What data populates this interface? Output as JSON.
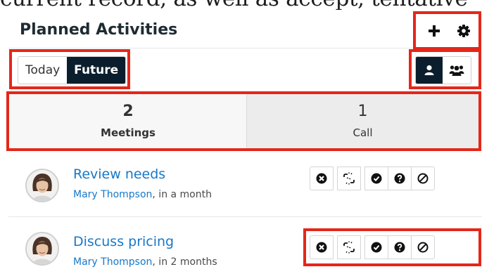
{
  "clipped_text": "current record, as well as accept, tentative",
  "dashlet": {
    "title": "Planned Activities",
    "add_icon": "plus-icon",
    "settings_icon": "gear-icon",
    "filter": {
      "today": "Today",
      "future": "Future",
      "selected": "Future"
    },
    "scope": {
      "mine_icon": "user-icon",
      "team_icon": "users-icon",
      "selected": "mine"
    },
    "tabs": [
      {
        "count": "2",
        "label": "Meetings",
        "active": true
      },
      {
        "count": "1",
        "label": "Call",
        "active": false
      }
    ],
    "items": [
      {
        "title": "Review needs",
        "assignee": "Mary Thompson",
        "when": ", in a month"
      },
      {
        "title": "Discuss pricing",
        "assignee": "Mary Thompson",
        "when": ", in 2 months"
      }
    ],
    "row_actions": [
      "close-icon",
      "unlink-icon",
      "accept-icon",
      "tentative-icon",
      "decline-icon"
    ]
  },
  "colors": {
    "highlight": "#e4271a",
    "accent": "#1778c9",
    "toggle_active": "#0b1e2e"
  }
}
